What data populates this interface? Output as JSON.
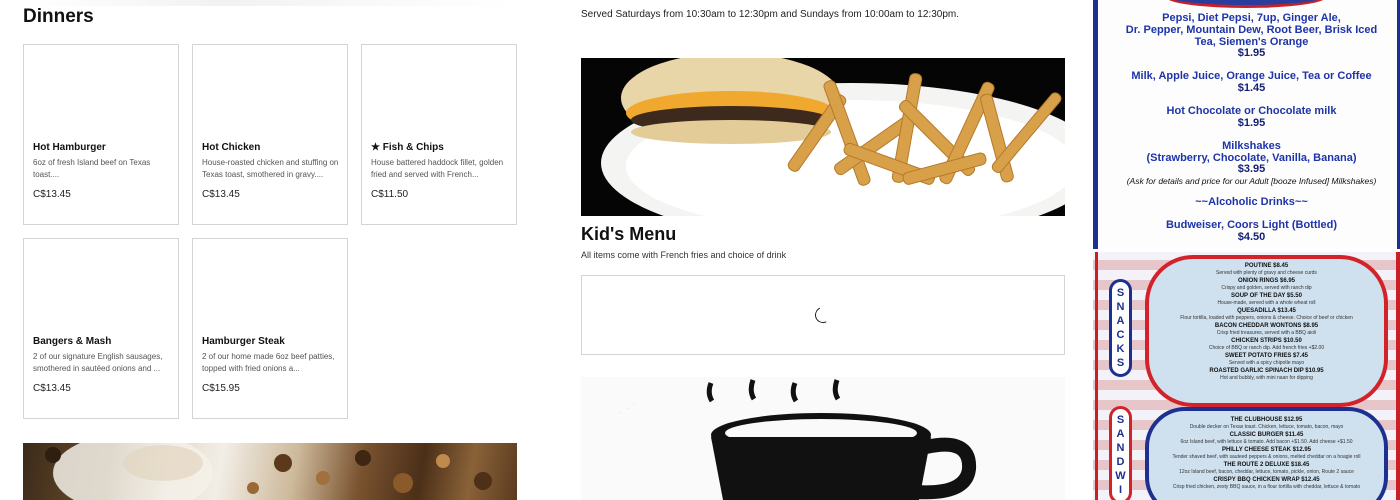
{
  "dinners": {
    "title": "Dinners",
    "items": [
      {
        "name": "Hot Hamburger",
        "desc": "6oz of fresh Island beef on Texas toast....",
        "price": "C$13.45"
      },
      {
        "name": "Hot Chicken",
        "desc": "House-roasted chicken and stuffing on Texas toast, smothered in gravy....",
        "price": "C$13.45"
      },
      {
        "name": "★ Fish & Chips",
        "desc": "House battered haddock fillet, golden fried and served with French...",
        "price": "C$11.50"
      },
      {
        "name": "Bangers & Mash",
        "desc": "2 of our signature English sausages, smothered in sautéed onions and ...",
        "price": "C$13.45"
      },
      {
        "name": "Hamburger Steak",
        "desc": "2 of our home made 6oz beef patties, topped with fried onions a...",
        "price": "C$15.95"
      }
    ]
  },
  "brunch": {
    "served": "Served Saturdays from 10:30am to 12:30pm and Sundays from 10:00am to 12:30pm."
  },
  "kids": {
    "title": "Kid's Menu",
    "subtitle": "All items come with French fries and choice of drink"
  },
  "drinks_board": {
    "lines": [
      {
        "text": "Pepsi, Diet Pepsi, 7up, Ginger Ale,",
        "kind": "item"
      },
      {
        "text": "Dr. Pepper, Mountain Dew, Root Beer, Brisk Iced",
        "kind": "item"
      },
      {
        "text": "Tea, Siemen's Orange",
        "kind": "item"
      },
      {
        "text": "$1.95",
        "kind": "price"
      },
      {
        "text": "Milk, Apple Juice, Orange Juice, Tea or Coffee",
        "kind": "item"
      },
      {
        "text": "$1.45",
        "kind": "price"
      },
      {
        "text": "Hot Chocolate or Chocolate milk",
        "kind": "item"
      },
      {
        "text": "$1.95",
        "kind": "price"
      },
      {
        "text": "Milkshakes",
        "kind": "item"
      },
      {
        "text": "(Strawberry, Chocolate, Vanilla, Banana)",
        "kind": "item"
      },
      {
        "text": "$3.95",
        "kind": "price"
      },
      {
        "text": "(Ask for details and price for our Adult [booze Infused] Milkshakes)",
        "kind": "note"
      },
      {
        "text": "~~Alcoholic Drinks~~",
        "kind": "item"
      },
      {
        "text": "Budweiser, Coors Light (Bottled)",
        "kind": "item"
      },
      {
        "text": "$4.50",
        "kind": "price"
      }
    ]
  },
  "snack_board": {
    "snacks_tab": [
      "S",
      "N",
      "A",
      "C",
      "K",
      "S"
    ],
    "sandwich_tab": [
      "S",
      "A",
      "N",
      "D",
      "W",
      "I"
    ],
    "snacks": [
      {
        "item": "POUTINE $8.45",
        "desc": "Served with plenty of gravy and cheese curds"
      },
      {
        "item": "ONION RINGS $6.95",
        "desc": "Crispy and golden, served with ranch dip"
      },
      {
        "item": "SOUP OF THE DAY $5.50",
        "desc": "House-made, served with a whole wheat roll"
      },
      {
        "item": "QUESADILLA $13.45",
        "desc": "Flour tortilla, loaded with peppers, onions & cheese. Choice of beef or chicken"
      },
      {
        "item": "BACON CHEDDAR WONTONS $8.95",
        "desc": "Crisp fried treasures, served with a BBQ aioli"
      },
      {
        "item": "CHICKEN STRIPS $10.50",
        "desc": "Choice of BBQ or ranch dip. Add french fries +$2.00"
      },
      {
        "item": "SWEET POTATO FRIES $7.45",
        "desc": "Served with a spicy chipotle mayo"
      },
      {
        "item": "ROASTED GARLIC SPINACH DIP $10.95",
        "desc": "Hot and bubbly, with mini naan for dipping"
      }
    ],
    "sandwiches": [
      {
        "item": "THE CLUBHOUSE $12.95",
        "desc": "Double decker on Texas toast. Chicken, lettuce, tomato, bacon, mayo"
      },
      {
        "item": "CLASSIC BURGER $11.45",
        "desc": "6oz Island beef, with lettuce & tomato. Add bacon +$1.50. Add cheese +$1.50"
      },
      {
        "item": "PHILLY CHEESE STEAK $12.95",
        "desc": "Tender shaved beef, with sauteed peppers & onions, melted cheddar on a hoagie roll"
      },
      {
        "item": "THE ROUTE 2 DELUXE $18.45",
        "desc": "12oz Island beef, bacon, cheddar, lettuce, tomato, pickle, onion, Route 2 sauce"
      },
      {
        "item": "CRISPY BBQ CHICKEN WRAP $12.45",
        "desc": "Crisp fried chicken, zesty BBQ sauce, in a flour tortilla with cheddar, lettuce & tomato"
      }
    ]
  }
}
